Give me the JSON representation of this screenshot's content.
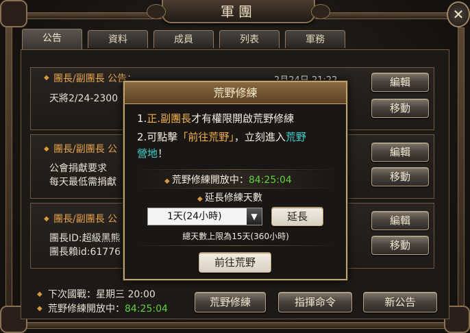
{
  "window": {
    "title": "軍團"
  },
  "tabs": [
    {
      "label": "公告",
      "active": true
    },
    {
      "label": "資料",
      "active": false
    },
    {
      "label": "成員",
      "active": false
    },
    {
      "label": "列表",
      "active": false
    },
    {
      "label": "軍務",
      "active": false
    }
  ],
  "announcements": [
    {
      "header": "團長/副團長 公告：",
      "date": "2月24日 21:22",
      "lines": [
        "天將2/24-2300"
      ],
      "edit_label": "編輯",
      "move_label": "移動"
    },
    {
      "header": "團長/副團長 公",
      "lines": [
        "公會捐獻要求",
        "每天最低需捐獻"
      ],
      "edit_label": "編輯",
      "move_label": "移動"
    },
    {
      "header": "團長/副團長 公",
      "lines": [
        "團長ID:超級黑熊",
        "團長賴id:61776"
      ],
      "edit_label": "編輯",
      "move_label": "移動"
    }
  ],
  "footer": {
    "next_war_label": "下次國戰：星期三 20:00",
    "wild_training_label": "荒野修練開放中：",
    "wild_training_timer": "84:25:04",
    "buttons": {
      "wild_training": "荒野修練",
      "command": "指揮命令",
      "new_announcement": "新公告"
    }
  },
  "modal": {
    "title": "荒野修練",
    "line1_prefix": "1.",
    "line1_highlight": "正.副團長",
    "line1_suffix": "才有權限開啟荒野修練",
    "line2_prefix": "2.可點擊",
    "line2_highlight": "「前往荒野」",
    "line2_middle": "，立刻進入",
    "line2_cyan_a": "荒野",
    "line2_cyan_b": "營地",
    "line2_end": "！",
    "status_label": "荒野修練開放中：",
    "status_timer": "84:25:04",
    "extend_title": "延長修練天數",
    "select_value": "1天(24小時)",
    "extend_button": "延長",
    "limit_note": "總天數上限為15天(360小時)",
    "go_button": "前往荒野"
  },
  "colors": {
    "accent_gold": "#c0a271",
    "timer_green": "#5fd23f",
    "highlight_orange": "#f0b14a",
    "highlight_cyan": "#3fd4d0"
  },
  "icons": {
    "bullet": "diamond-icon",
    "dropdown": "triangle-down-icon",
    "close": "close-icon"
  }
}
